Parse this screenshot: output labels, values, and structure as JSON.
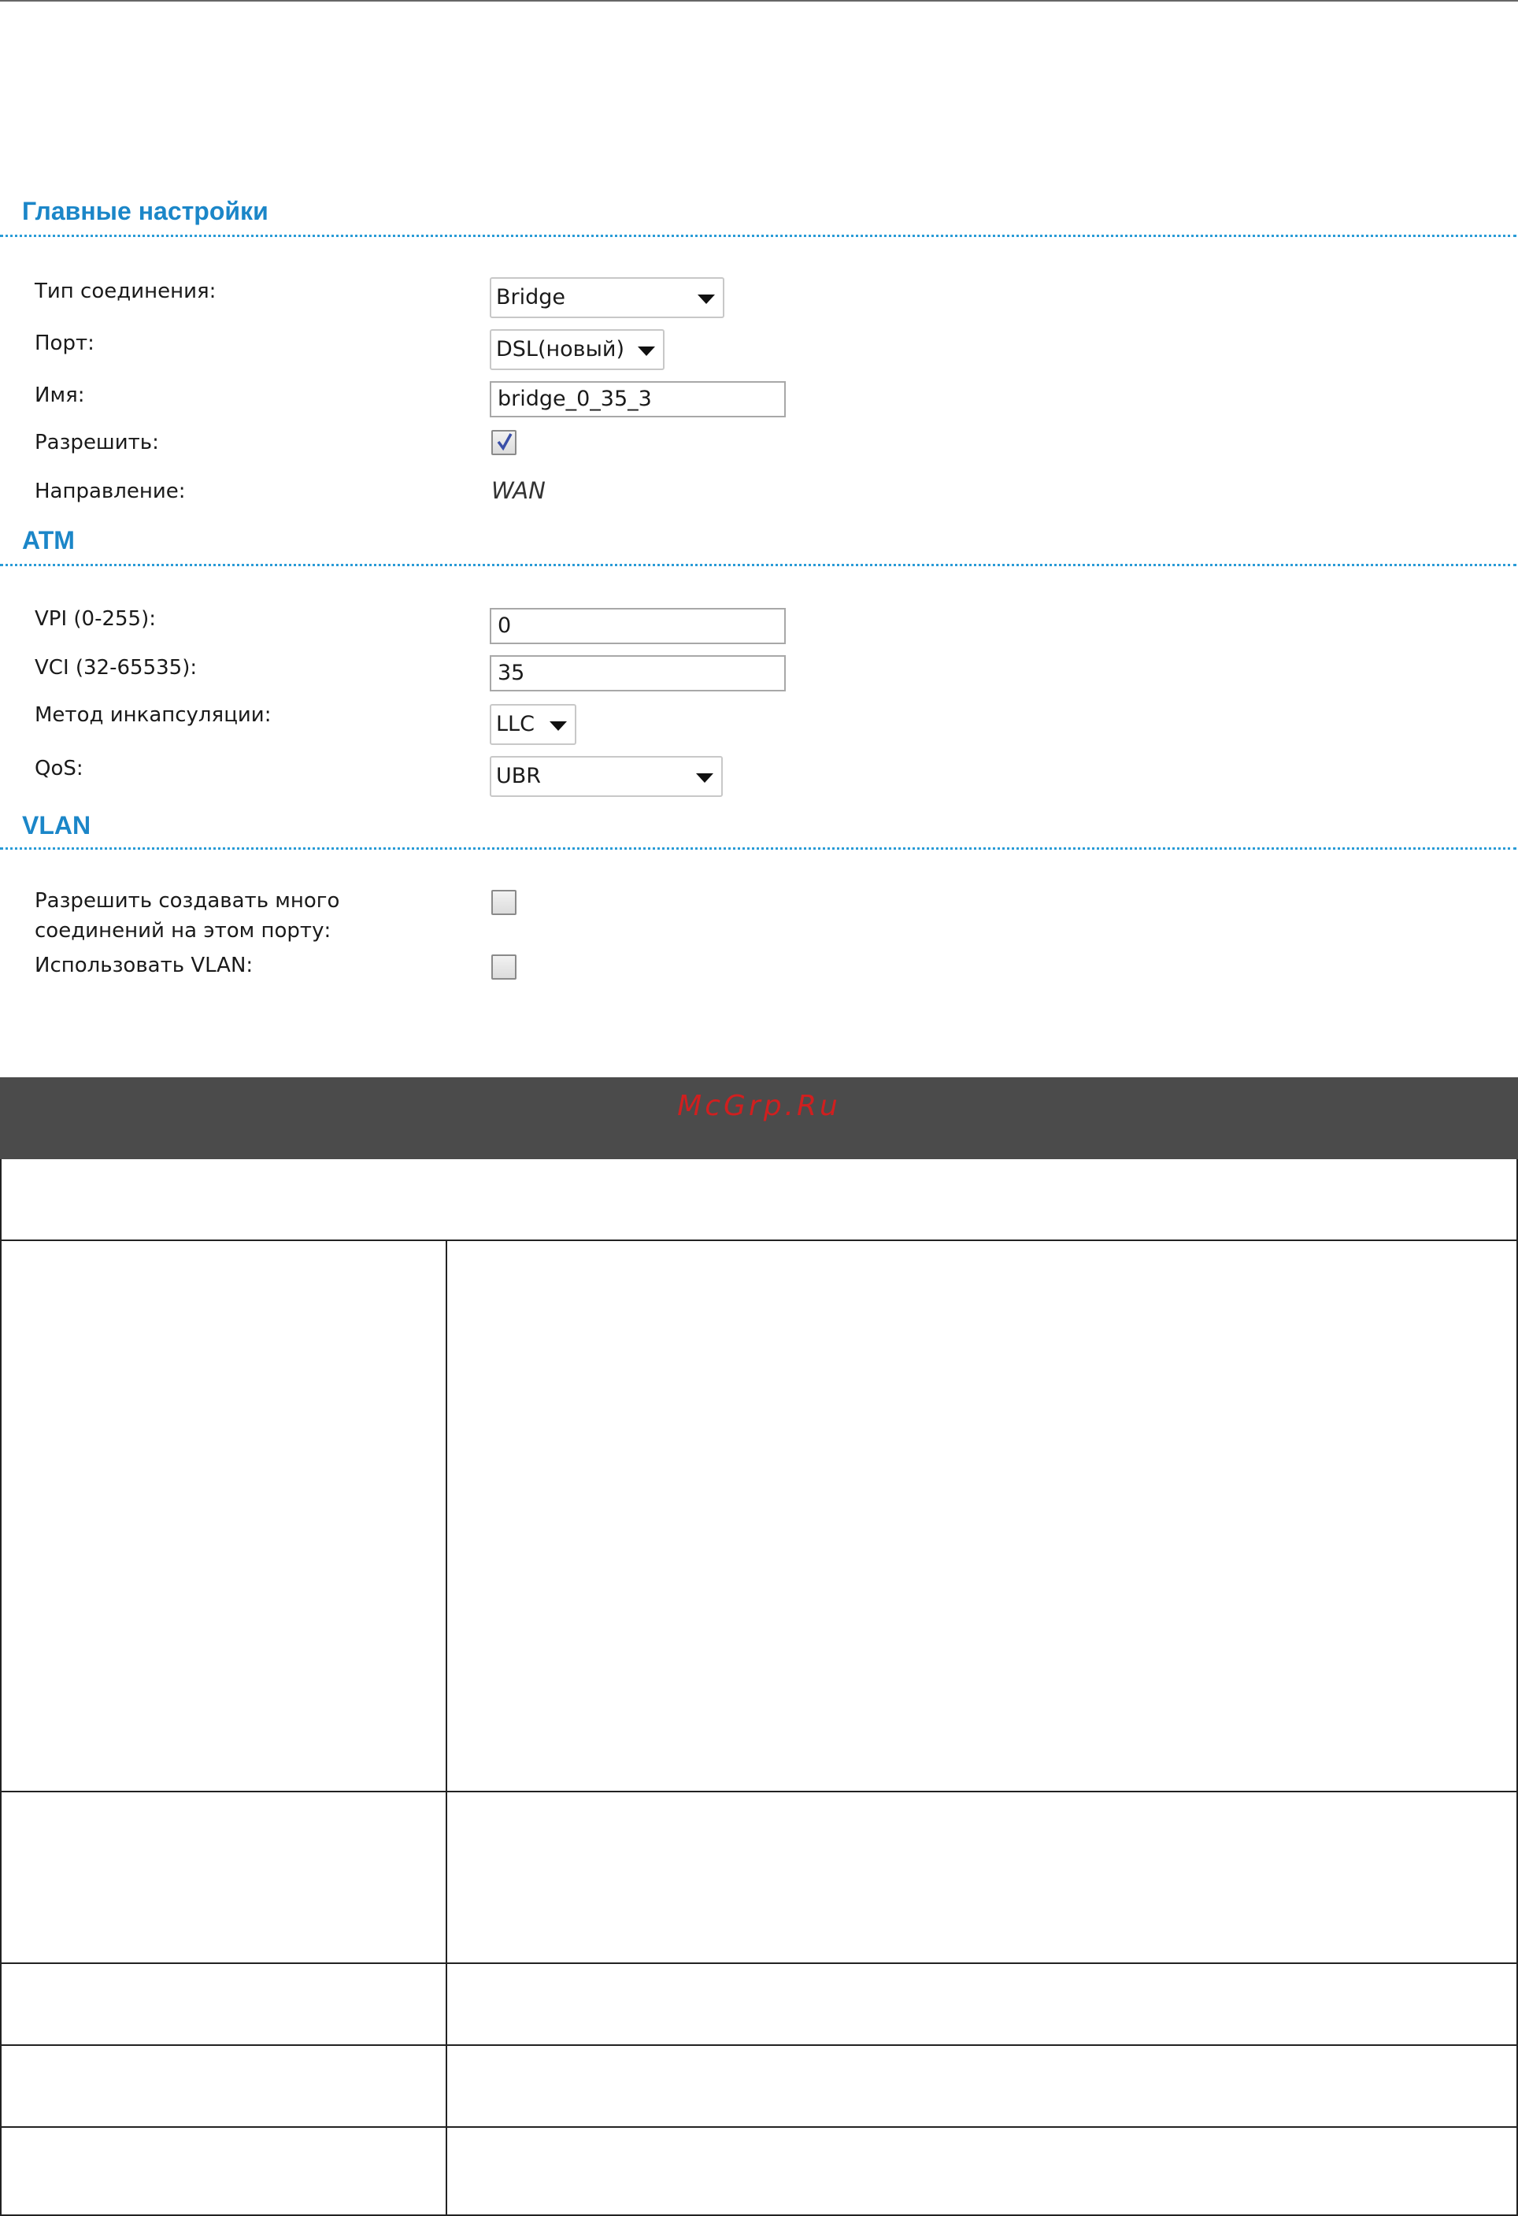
{
  "sections": {
    "main": {
      "title": "Главные настройки",
      "connection_type": {
        "label": "Тип соединения:",
        "value": "Bridge"
      },
      "port": {
        "label": "Порт:",
        "value": "DSL(новый)"
      },
      "name": {
        "label": "Имя:",
        "value": "bridge_0_35_3"
      },
      "enable": {
        "label": "Разрешить:",
        "checked": true
      },
      "direction": {
        "label": "Направление:",
        "value": "WAN"
      }
    },
    "atm": {
      "title": "ATM",
      "vpi": {
        "label": "VPI (0-255):",
        "value": "0"
      },
      "vci": {
        "label": "VCI (32-65535):",
        "value": "35"
      },
      "encapsulation": {
        "label": "Метод инкапсуляции:",
        "value": "LLC"
      },
      "qos": {
        "label": "QoS:",
        "value": "UBR"
      }
    },
    "vlan": {
      "title": "VLAN",
      "multi_connections": {
        "label_line1": "Разрешить создавать много",
        "label_line2": "соединений на этом порту:",
        "checked": false
      },
      "use_vlan": {
        "label": "Использовать VLAN:",
        "checked": false
      }
    }
  },
  "watermark": "McGrp.Ru",
  "colors": {
    "section_title": "#1b86c8",
    "banner": "#4b4b4b",
    "watermark": "#d01f1f"
  }
}
